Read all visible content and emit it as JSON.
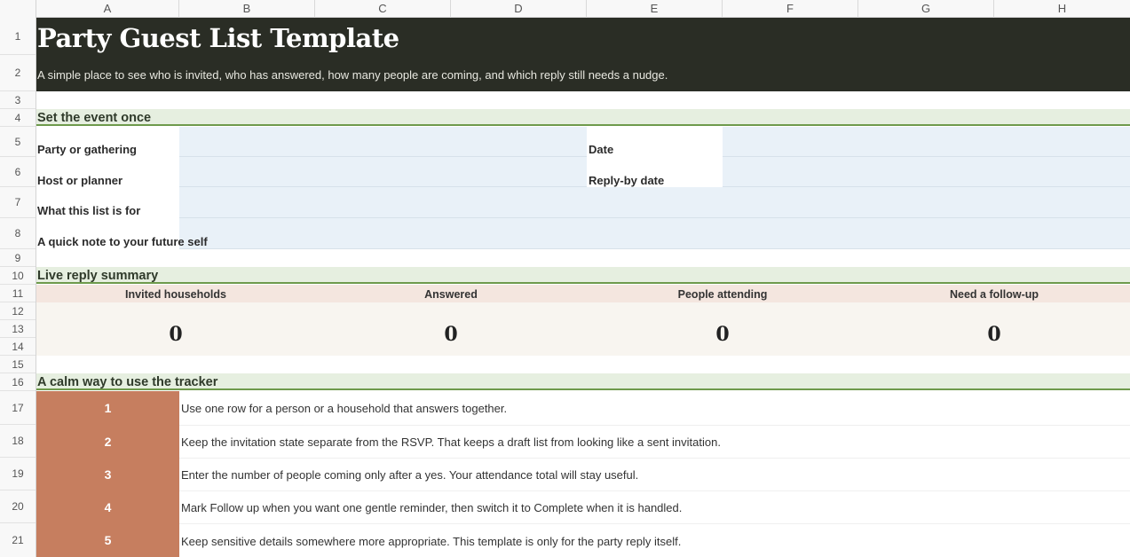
{
  "columns": [
    "A",
    "B",
    "C",
    "D",
    "E",
    "F",
    "G",
    "H"
  ],
  "rows": [
    "1",
    "2",
    "3",
    "4",
    "5",
    "6",
    "7",
    "8",
    "9",
    "10",
    "11",
    "12",
    "13",
    "14",
    "15",
    "16",
    "17",
    "18",
    "19",
    "20",
    "21"
  ],
  "banner": {
    "title": "Party Guest List Template",
    "subtitle": "A simple place to see who is invited, who has answered, how many people are coming, and which reply still needs a nudge."
  },
  "event_section": {
    "title": "Set the event once",
    "fields": {
      "party": "Party or gathering",
      "date": "Date",
      "host": "Host or planner",
      "reply_by": "Reply-by date",
      "purpose": "What this list is for",
      "note": "A quick note to your future self"
    }
  },
  "summary_section": {
    "title": "Live reply summary",
    "metrics": [
      {
        "label": "Invited households",
        "value": "0"
      },
      {
        "label": "Answered",
        "value": "0"
      },
      {
        "label": "People attending",
        "value": "0"
      },
      {
        "label": "Need a follow-up",
        "value": "0"
      }
    ]
  },
  "steps_section": {
    "title": "A calm way to use the tracker",
    "steps": [
      {
        "num": "1",
        "text": "Use one row for a person or a household that answers together."
      },
      {
        "num": "2",
        "text": "Keep the invitation state separate from the RSVP. That keeps a draft list from looking like a sent invitation."
      },
      {
        "num": "3",
        "text": "Enter the number of people coming only after a yes. Your attendance total will stay useful."
      },
      {
        "num": "4",
        "text": "Mark Follow up when you want one gentle reminder, then switch it to Complete when it is handled."
      },
      {
        "num": "5",
        "text": "Keep sensitive details somewhere more appropriate. This template is only for the party reply itself."
      }
    ]
  }
}
